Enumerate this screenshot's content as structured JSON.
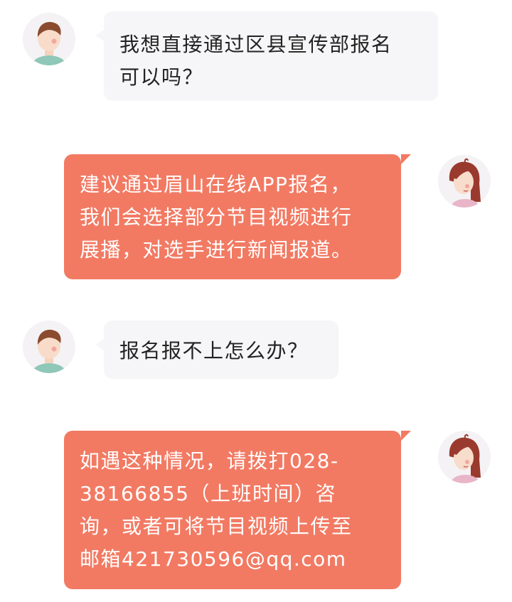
{
  "messages": [
    {
      "role": "user",
      "avatar": "boy-avatar-icon",
      "text": "我想直接通过区县宣传部报名\n可以吗？"
    },
    {
      "role": "agent",
      "avatar": "girl-avatar-icon",
      "text": "建议通过眉山在线APP报名，\n我们会选择部分节目视频进行\n展播，对选手进行新闻报道。"
    },
    {
      "role": "user",
      "avatar": "boy-avatar-icon",
      "text": "报名报不上怎么办？"
    },
    {
      "role": "agent",
      "avatar": "girl-avatar-icon",
      "text": "如遇这种情况，请拨打028-\n38166855（上班时间）咨\n询，或者可将节目视频上传至\n邮箱421730596@qq.com"
    }
  ],
  "colors": {
    "agent_bubble": "#f27a63",
    "user_bubble": "#f6f5f7",
    "agent_text": "#ffffff",
    "user_text": "#222222"
  }
}
